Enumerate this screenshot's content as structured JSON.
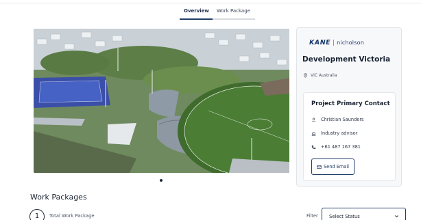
{
  "tabs": [
    {
      "label": "Overview",
      "active": true
    },
    {
      "label": "Work Package",
      "active": false
    }
  ],
  "hero": {
    "image_alt": "Aerial render of sports oval, grandstands and hockey pitch",
    "carousel_dots": 1
  },
  "company": {
    "logo_primary": "KANE",
    "logo_secondary": "nicholson",
    "client_name": "Development Victoria",
    "location": "VIC Australia"
  },
  "contact": {
    "title": "Project Primary Contact",
    "name": "Christian Saunders",
    "role": "Industry advisor",
    "phone": "+61 487 167 381",
    "email_button": "Send Email"
  },
  "work_packages": {
    "heading": "Work Packages",
    "total_count": "1",
    "total_label": "Total Work Package",
    "filter_label": "Filter",
    "filter_value": "Select Status"
  },
  "colors": {
    "brand_navy": "#1f3d63",
    "text_dark": "#1a2332",
    "card_bg": "#f7f8fa"
  }
}
